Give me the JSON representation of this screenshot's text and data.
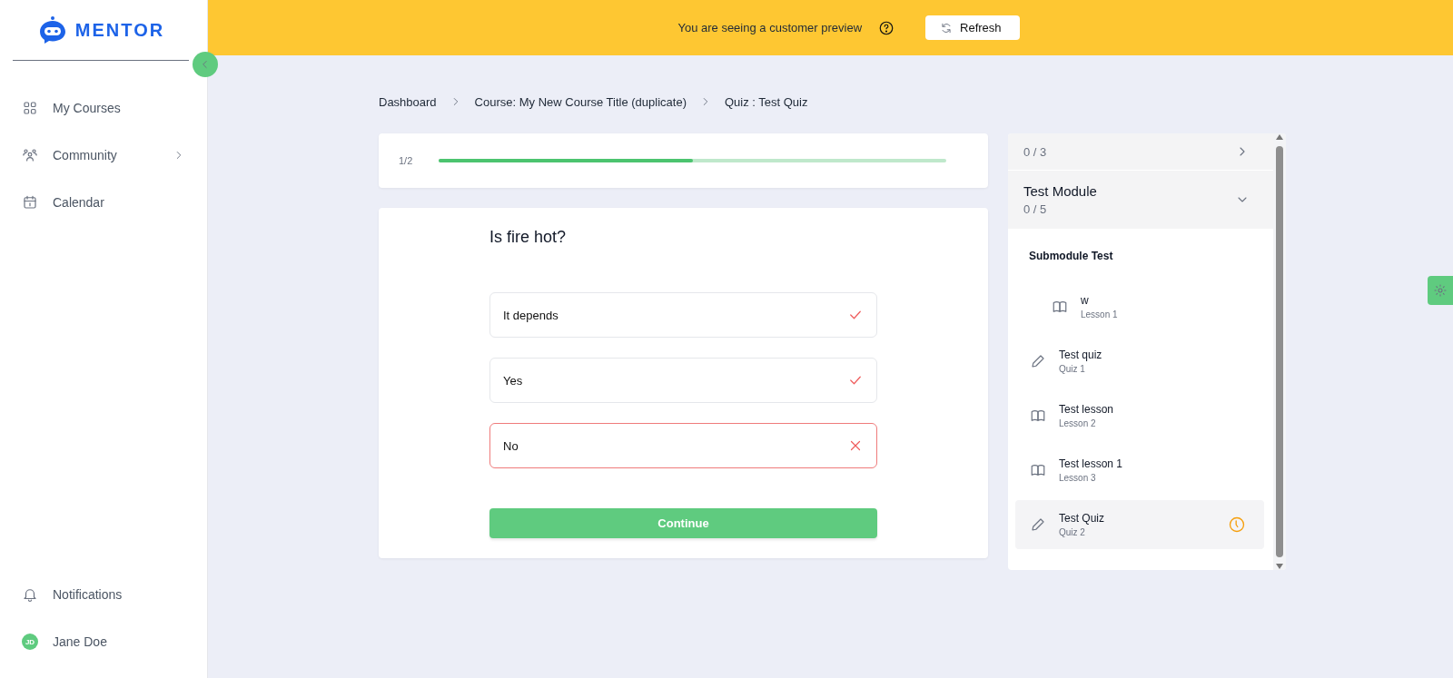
{
  "sidebar": {
    "logo": "MENTOR",
    "items": [
      {
        "label": "My Courses",
        "kind": "grid",
        "has_submenu": false
      },
      {
        "label": "Community",
        "kind": "people",
        "has_submenu": true
      },
      {
        "label": "Calendar",
        "kind": "calendar",
        "has_submenu": false
      }
    ],
    "footer": [
      {
        "label": "Notifications",
        "kind": "bell"
      },
      {
        "label": "Jane Doe",
        "kind": "avatar",
        "initials": "JD"
      }
    ]
  },
  "banner": {
    "text": "You are seeing a customer preview",
    "button": "Refresh"
  },
  "breadcrumb": [
    "Dashboard",
    "Course: My New Course Title (duplicate)",
    "Quiz : Test Quiz"
  ],
  "progress": {
    "label": "1/2",
    "level": 0.5
  },
  "quiz": {
    "question": "Is fire hot?",
    "options": [
      {
        "label": "It depends",
        "kind": "check"
      },
      {
        "label": "Yes",
        "kind": "check"
      },
      {
        "label": "No",
        "kind": "cross"
      }
    ],
    "button": "Continue"
  },
  "outline": {
    "modules": [
      {
        "count": "0 / 3",
        "expanded": false
      },
      {
        "title": "Test Module",
        "count": "0 / 5",
        "expanded": true,
        "items": [
          {
            "kind": "submodule",
            "title": "Submodule Test",
            "children": [
              {
                "kind": "lesson",
                "title": "w",
                "subtitle": "Lesson 1",
                "selected": false,
                "in_progress": false
              }
            ]
          },
          {
            "kind": "quiz",
            "title": "Test quiz",
            "subtitle": "Quiz 1",
            "selected": false,
            "in_progress": false
          },
          {
            "kind": "lesson",
            "title": "Test lesson",
            "subtitle": "Lesson 2",
            "selected": false,
            "in_progress": false
          },
          {
            "kind": "lesson",
            "title": "Test lesson 1",
            "subtitle": "Lesson 3",
            "selected": false,
            "in_progress": false
          },
          {
            "kind": "quiz",
            "title": "Test Quiz",
            "subtitle": "Quiz 2",
            "selected": true,
            "in_progress": true
          }
        ]
      }
    ]
  }
}
